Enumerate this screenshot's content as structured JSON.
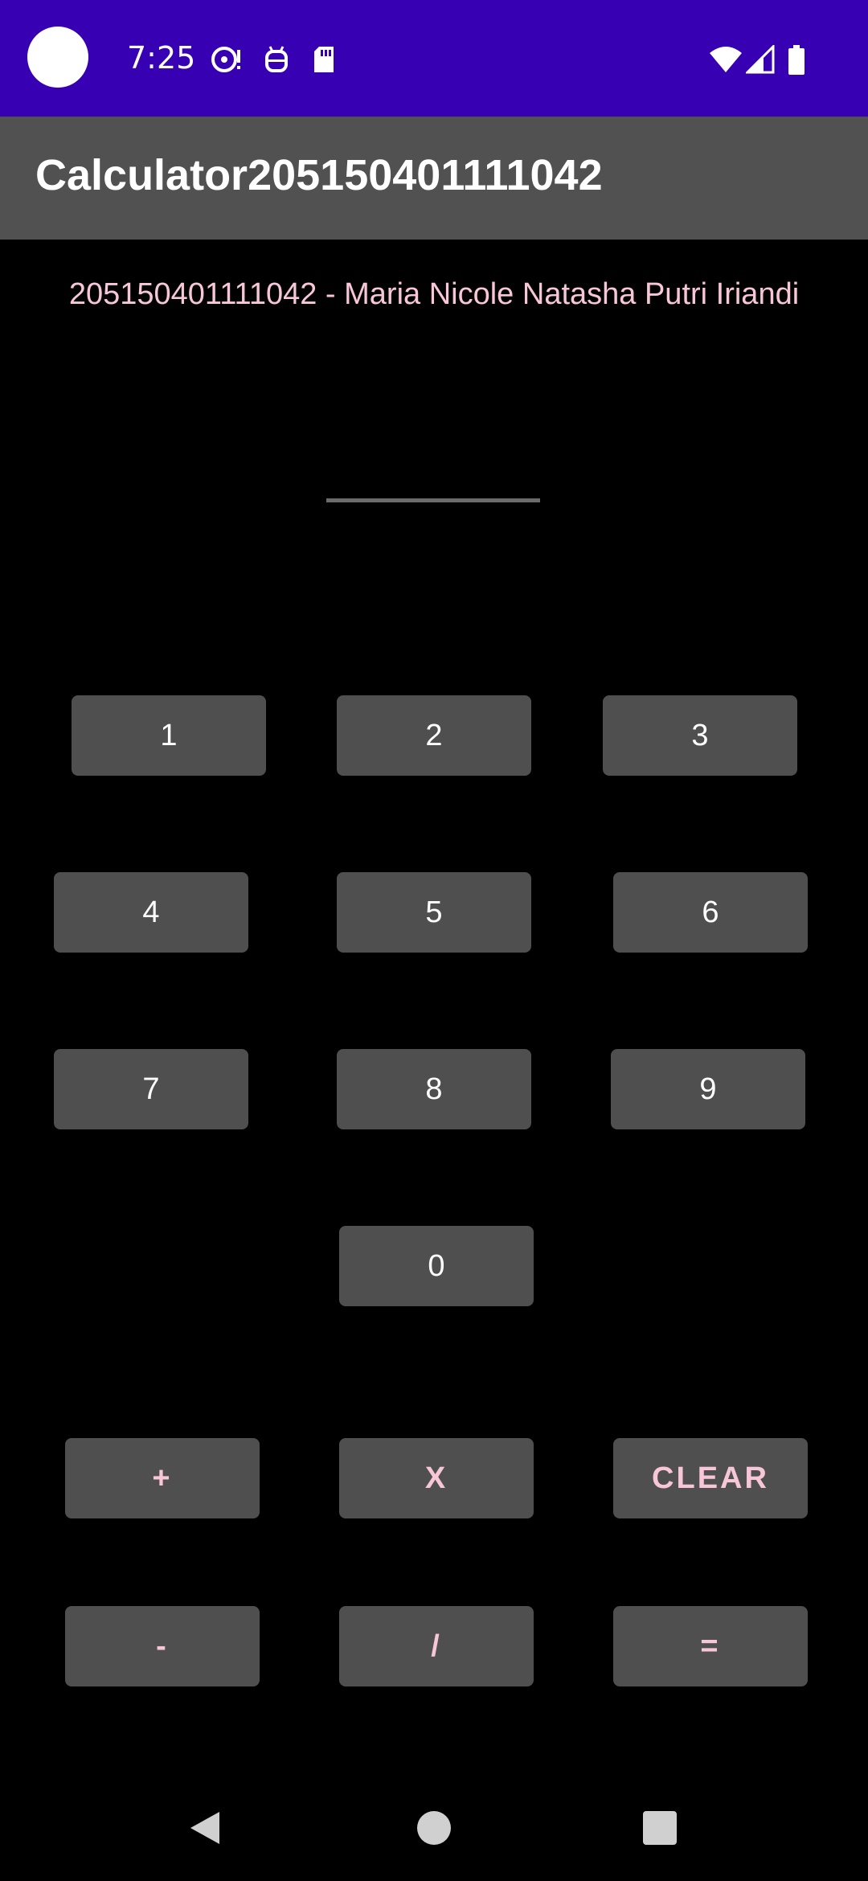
{
  "status_bar": {
    "time": "7:25",
    "icons_left": [
      "media-icon",
      "android-debug-icon",
      "sd-card-icon"
    ],
    "icons_right": [
      "wifi-icon",
      "signal-icon",
      "battery-icon"
    ],
    "color": "#3700b3"
  },
  "app_bar": {
    "title": "Calculator205150401111042",
    "color": "#515151"
  },
  "subtitle": "205150401111042 - Maria Nicole Natasha Putri Iriandi",
  "display": {
    "value": ""
  },
  "keys": {
    "k1": "1",
    "k2": "2",
    "k3": "3",
    "k4": "4",
    "k5": "5",
    "k6": "6",
    "k7": "7",
    "k8": "8",
    "k9": "9",
    "k0": "0",
    "plus": "+",
    "times": "X",
    "clear": "CLEAR",
    "minus": "-",
    "divide": "/",
    "equals": "="
  },
  "colors": {
    "accent_text": "#f7c6d8",
    "button_bg": "#4f4f4f"
  },
  "nav_bar": {
    "icons": [
      "back-icon",
      "home-icon",
      "recents-icon"
    ]
  }
}
